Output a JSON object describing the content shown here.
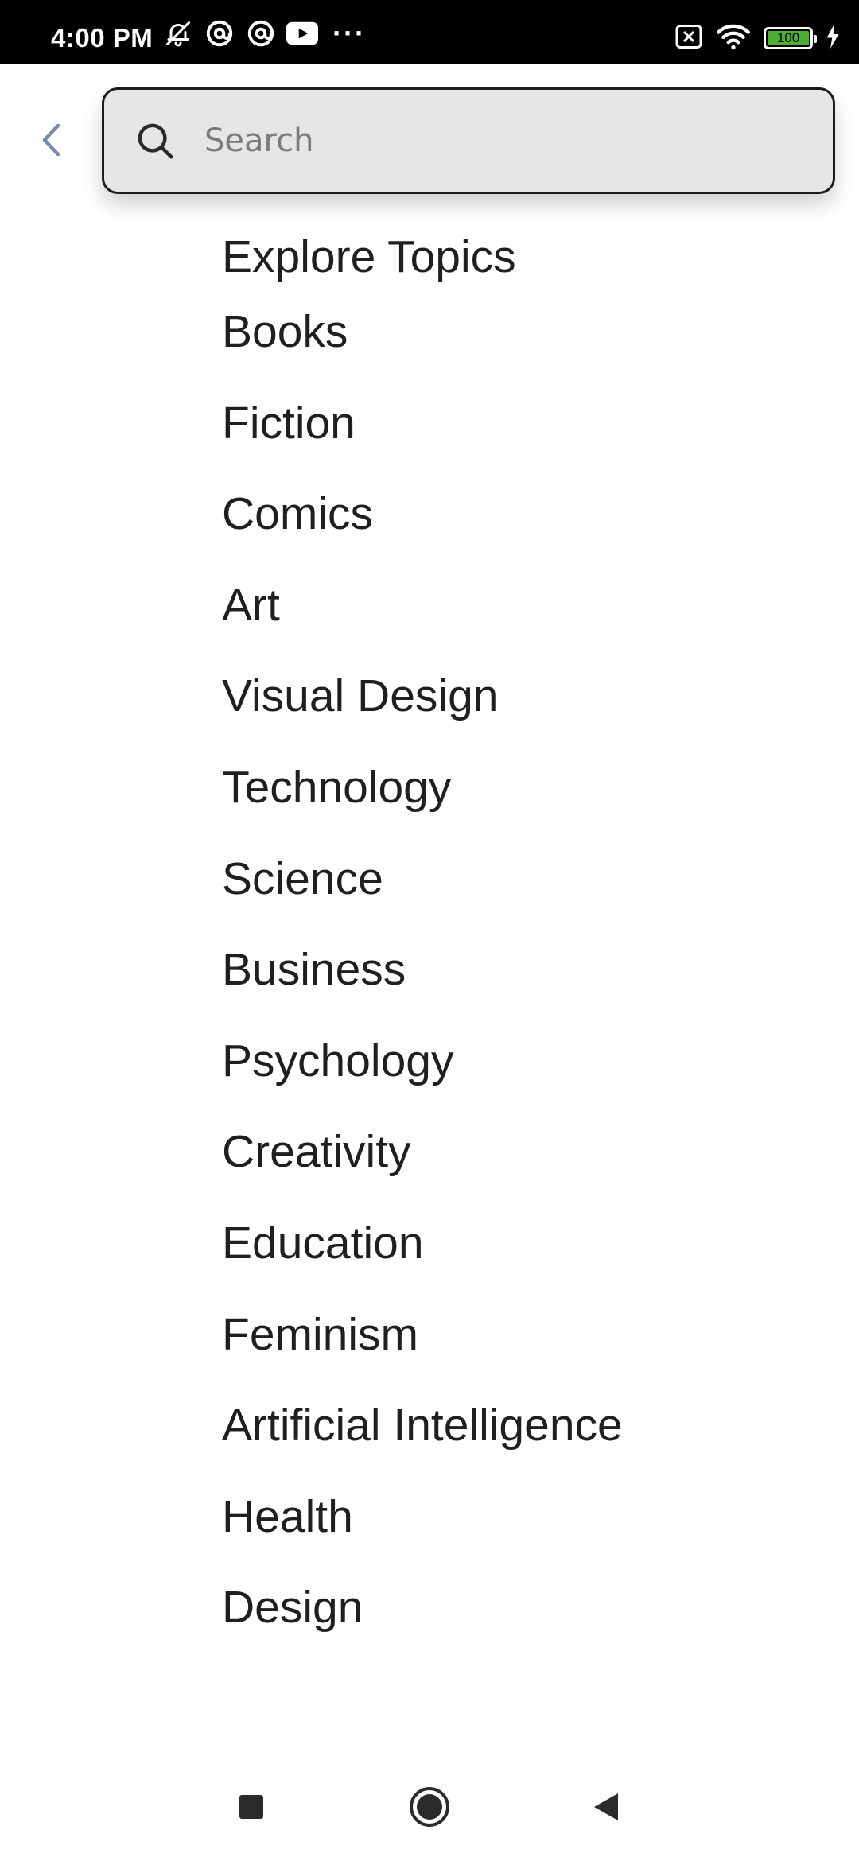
{
  "status_bar": {
    "time": "4:00 PM",
    "battery_level": "100",
    "icons_left": [
      "notifications-off-icon",
      "at-sign-icon",
      "at-sign-icon",
      "youtube-icon",
      "more-dots-icon"
    ],
    "icons_right": [
      "sim-off-icon",
      "wifi-icon",
      "battery-icon",
      "charging-icon"
    ],
    "dots": "···"
  },
  "header": {
    "back_icon": "chevron-left-icon",
    "search": {
      "placeholder": "Search",
      "value": "",
      "icon": "search-icon"
    }
  },
  "explore": {
    "title": "Explore Topics",
    "topics": [
      "Books",
      "Fiction",
      "Comics",
      "Art",
      "Visual Design",
      "Technology",
      "Science",
      "Business",
      "Psychology",
      "Creativity",
      "Education",
      "Feminism",
      "Artificial Intelligence",
      "Health",
      "Design"
    ]
  },
  "nav_bar": {
    "buttons": [
      "recents-square-icon",
      "home-circle-icon",
      "back-triangle-icon"
    ]
  },
  "colors": {
    "status_bar_bg": "#000000",
    "search_bg": "#e6e6e6",
    "text": "#1f1f1f",
    "back_chevron": "#7b8aa8",
    "battery_green": "#4caf2f"
  }
}
